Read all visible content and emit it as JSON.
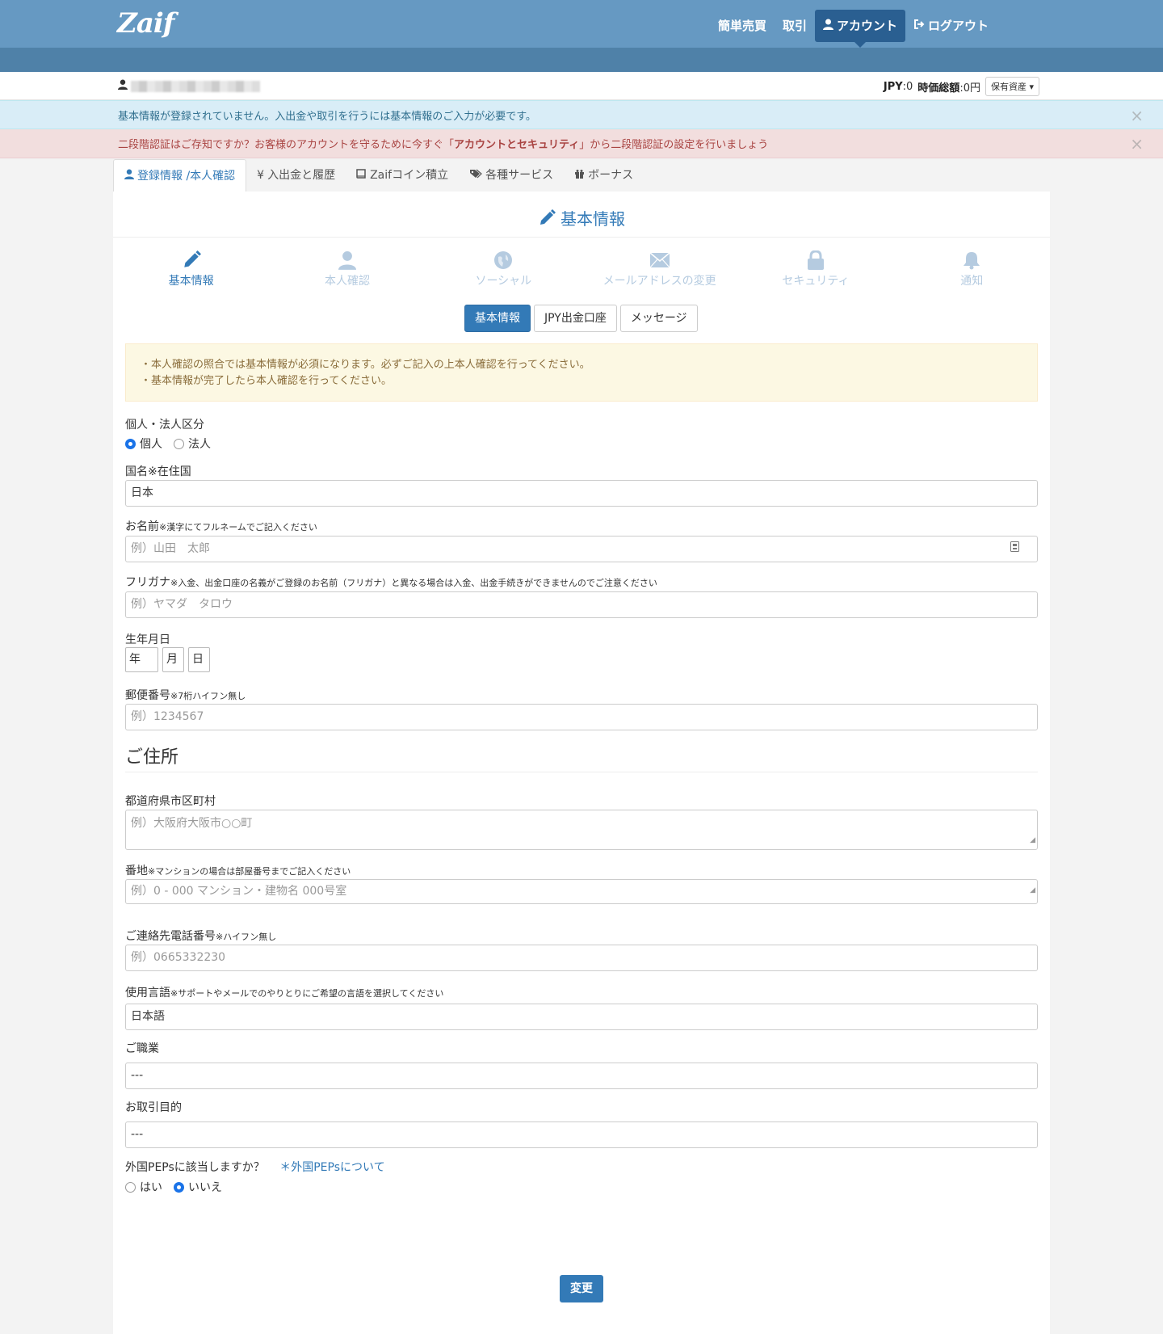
{
  "header": {
    "logo": "Zaif",
    "nav": [
      {
        "label": "簡単売買"
      },
      {
        "label": "取引"
      },
      {
        "label": "アカウント"
      },
      {
        "label": "ログアウト"
      }
    ]
  },
  "userbar": {
    "jpy_label": "JPY",
    "jpy_value": ":0",
    "total_label": "時価総額",
    "total_value": ":0円",
    "assets_button": "保有資産"
  },
  "alerts": {
    "info": "基本情報が登録されていません。入出金や取引を行うには基本情報のご入力が必要です。",
    "danger_prefix": "二段階認証はご存知ですか？お客様のアカウントを守るために今すぐ「",
    "danger_bold": "アカウントとセキュリティ",
    "danger_suffix": "」から二段階認証の設定を行いましょう",
    "close": "×"
  },
  "tabs": [
    {
      "label": "登録情報 /本人確認"
    },
    {
      "label": "入出金と履歴"
    },
    {
      "label": "Zaifコイン積立"
    },
    {
      "label": "各種サービス"
    },
    {
      "label": "ボーナス"
    }
  ],
  "section_title": "基本情報",
  "steps": [
    {
      "label": "基本情報"
    },
    {
      "label": "本人確認"
    },
    {
      "label": "ソーシャル"
    },
    {
      "label": "メールアドレスの変更"
    },
    {
      "label": "セキュリティ"
    },
    {
      "label": "通知"
    }
  ],
  "subtabs": [
    {
      "label": "基本情報"
    },
    {
      "label": "JPY出金口座"
    },
    {
      "label": "メッセージ"
    }
  ],
  "warning": {
    "line1": "・本人確認の照合では基本情報が必須になります。必ずご記入の上本人確認を行ってください。",
    "line2": "・基本情報が完了したら本人確認を行ってください。"
  },
  "form": {
    "type_label": "個人・法人区分",
    "type_options": [
      "個人",
      "法人"
    ],
    "country_label": "国名※在住国",
    "country_value": "日本",
    "name_label": "お名前",
    "name_note": "※漢字にてフルネームでご記入ください",
    "name_placeholder": "例）山田　太郎",
    "kana_label": "フリガナ",
    "kana_note": "※入金、出金口座の名義がご登録のお名前（フリガナ）と異なる場合は入金、出金手続きができませんのでご注意ください",
    "kana_placeholder": "例）ヤマダ　タロウ",
    "birth_label": "生年月日",
    "birth_year": "年",
    "birth_month": "月",
    "birth_day": "日",
    "zip_label": "郵便番号",
    "zip_note": "※7桁ハイフン無し",
    "zip_placeholder": "例）1234567",
    "address_heading": "ご住所",
    "city_label": "都道府県市区町村",
    "city_placeholder": "例）大阪府大阪市○○町",
    "street_label": "番地",
    "street_note": "※マンションの場合は部屋番号までご記入ください",
    "street_placeholder": "例）0 - 000 マンション・建物名 000号室",
    "phone_label": "ご連絡先電話番号",
    "phone_note": "※ハイフン無し",
    "phone_placeholder": "例）0665332230",
    "lang_label": "使用言語",
    "lang_note": "※サポートやメールでのやりとりにご希望の言語を選択してください",
    "lang_value": "日本語",
    "job_label": "ご職業",
    "job_value": "---",
    "purpose_label": "お取引目的",
    "purpose_value": "---",
    "peps_label": "外国PEPsに該当しますか？",
    "peps_link": "＊外国PEPsについて",
    "peps_options": [
      "はい",
      "いいえ"
    ],
    "submit": "変更"
  }
}
